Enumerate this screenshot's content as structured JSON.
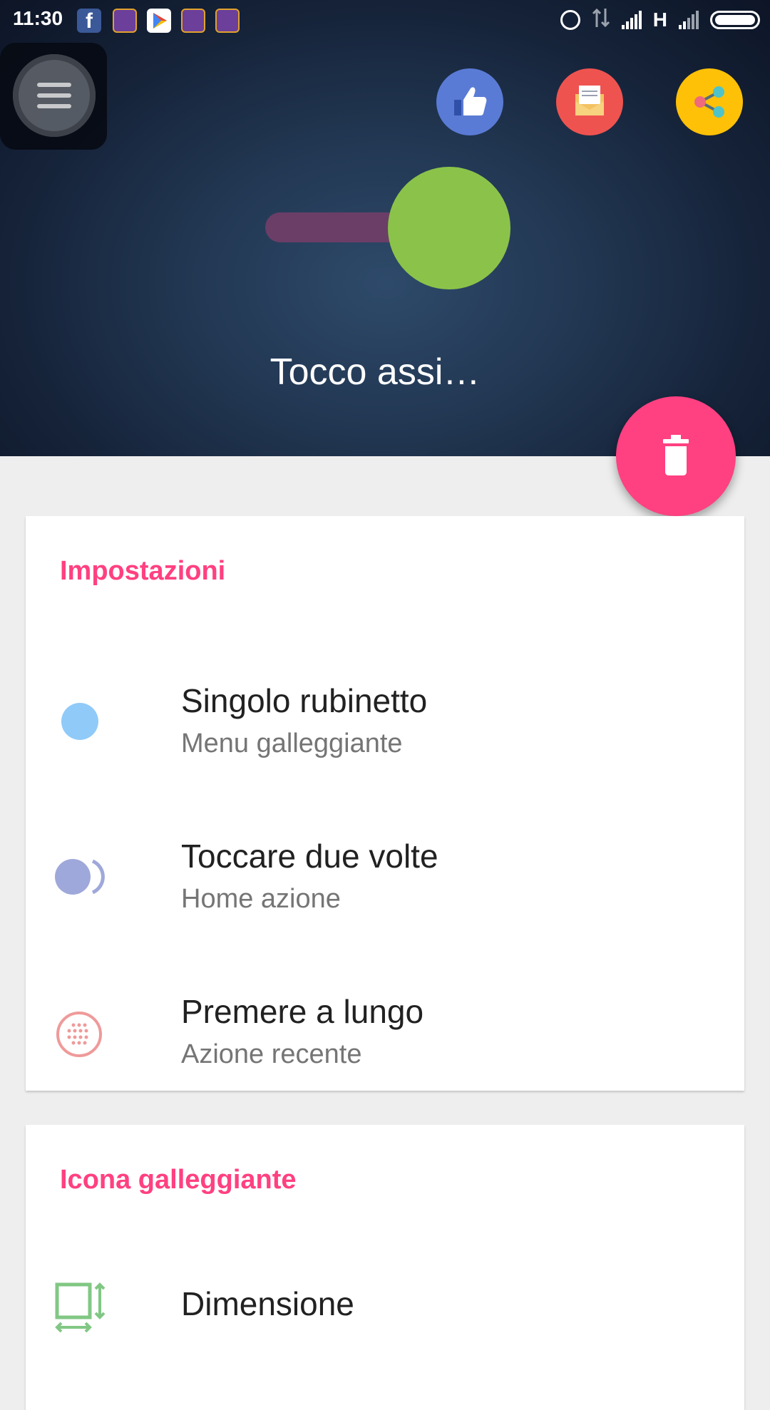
{
  "status_bar": {
    "time": "11:30",
    "network_type": "H",
    "icons": [
      "facebook-icon",
      "game-icon",
      "play-store-icon",
      "game-icon",
      "game-icon",
      "alarm-icon",
      "data-transfer-icon",
      "signal-icon",
      "signal-icon",
      "battery-icon"
    ]
  },
  "header": {
    "title": "Tocco assi…",
    "toggle_on": true,
    "colors": {
      "like": "#5a7bd5",
      "mail": "#ef5350",
      "share": "#ffc107",
      "toggle_knob": "#8bc34a",
      "fab": "#ff4081"
    }
  },
  "settings_card": {
    "title": "Impostazioni",
    "items": [
      {
        "title": "Singolo rubinetto",
        "subtitle": "Menu galleggiante",
        "icon": "single-tap-icon"
      },
      {
        "title": "Toccare due volte",
        "subtitle": "Home azione",
        "icon": "double-tap-icon"
      },
      {
        "title": "Premere a lungo",
        "subtitle": "Azione recente",
        "icon": "long-press-icon"
      }
    ]
  },
  "floating_icon_card": {
    "title": "Icona galleggiante",
    "items": [
      {
        "title": "Dimensione",
        "icon": "resize-icon"
      }
    ]
  },
  "accent_color": "#ff4081"
}
